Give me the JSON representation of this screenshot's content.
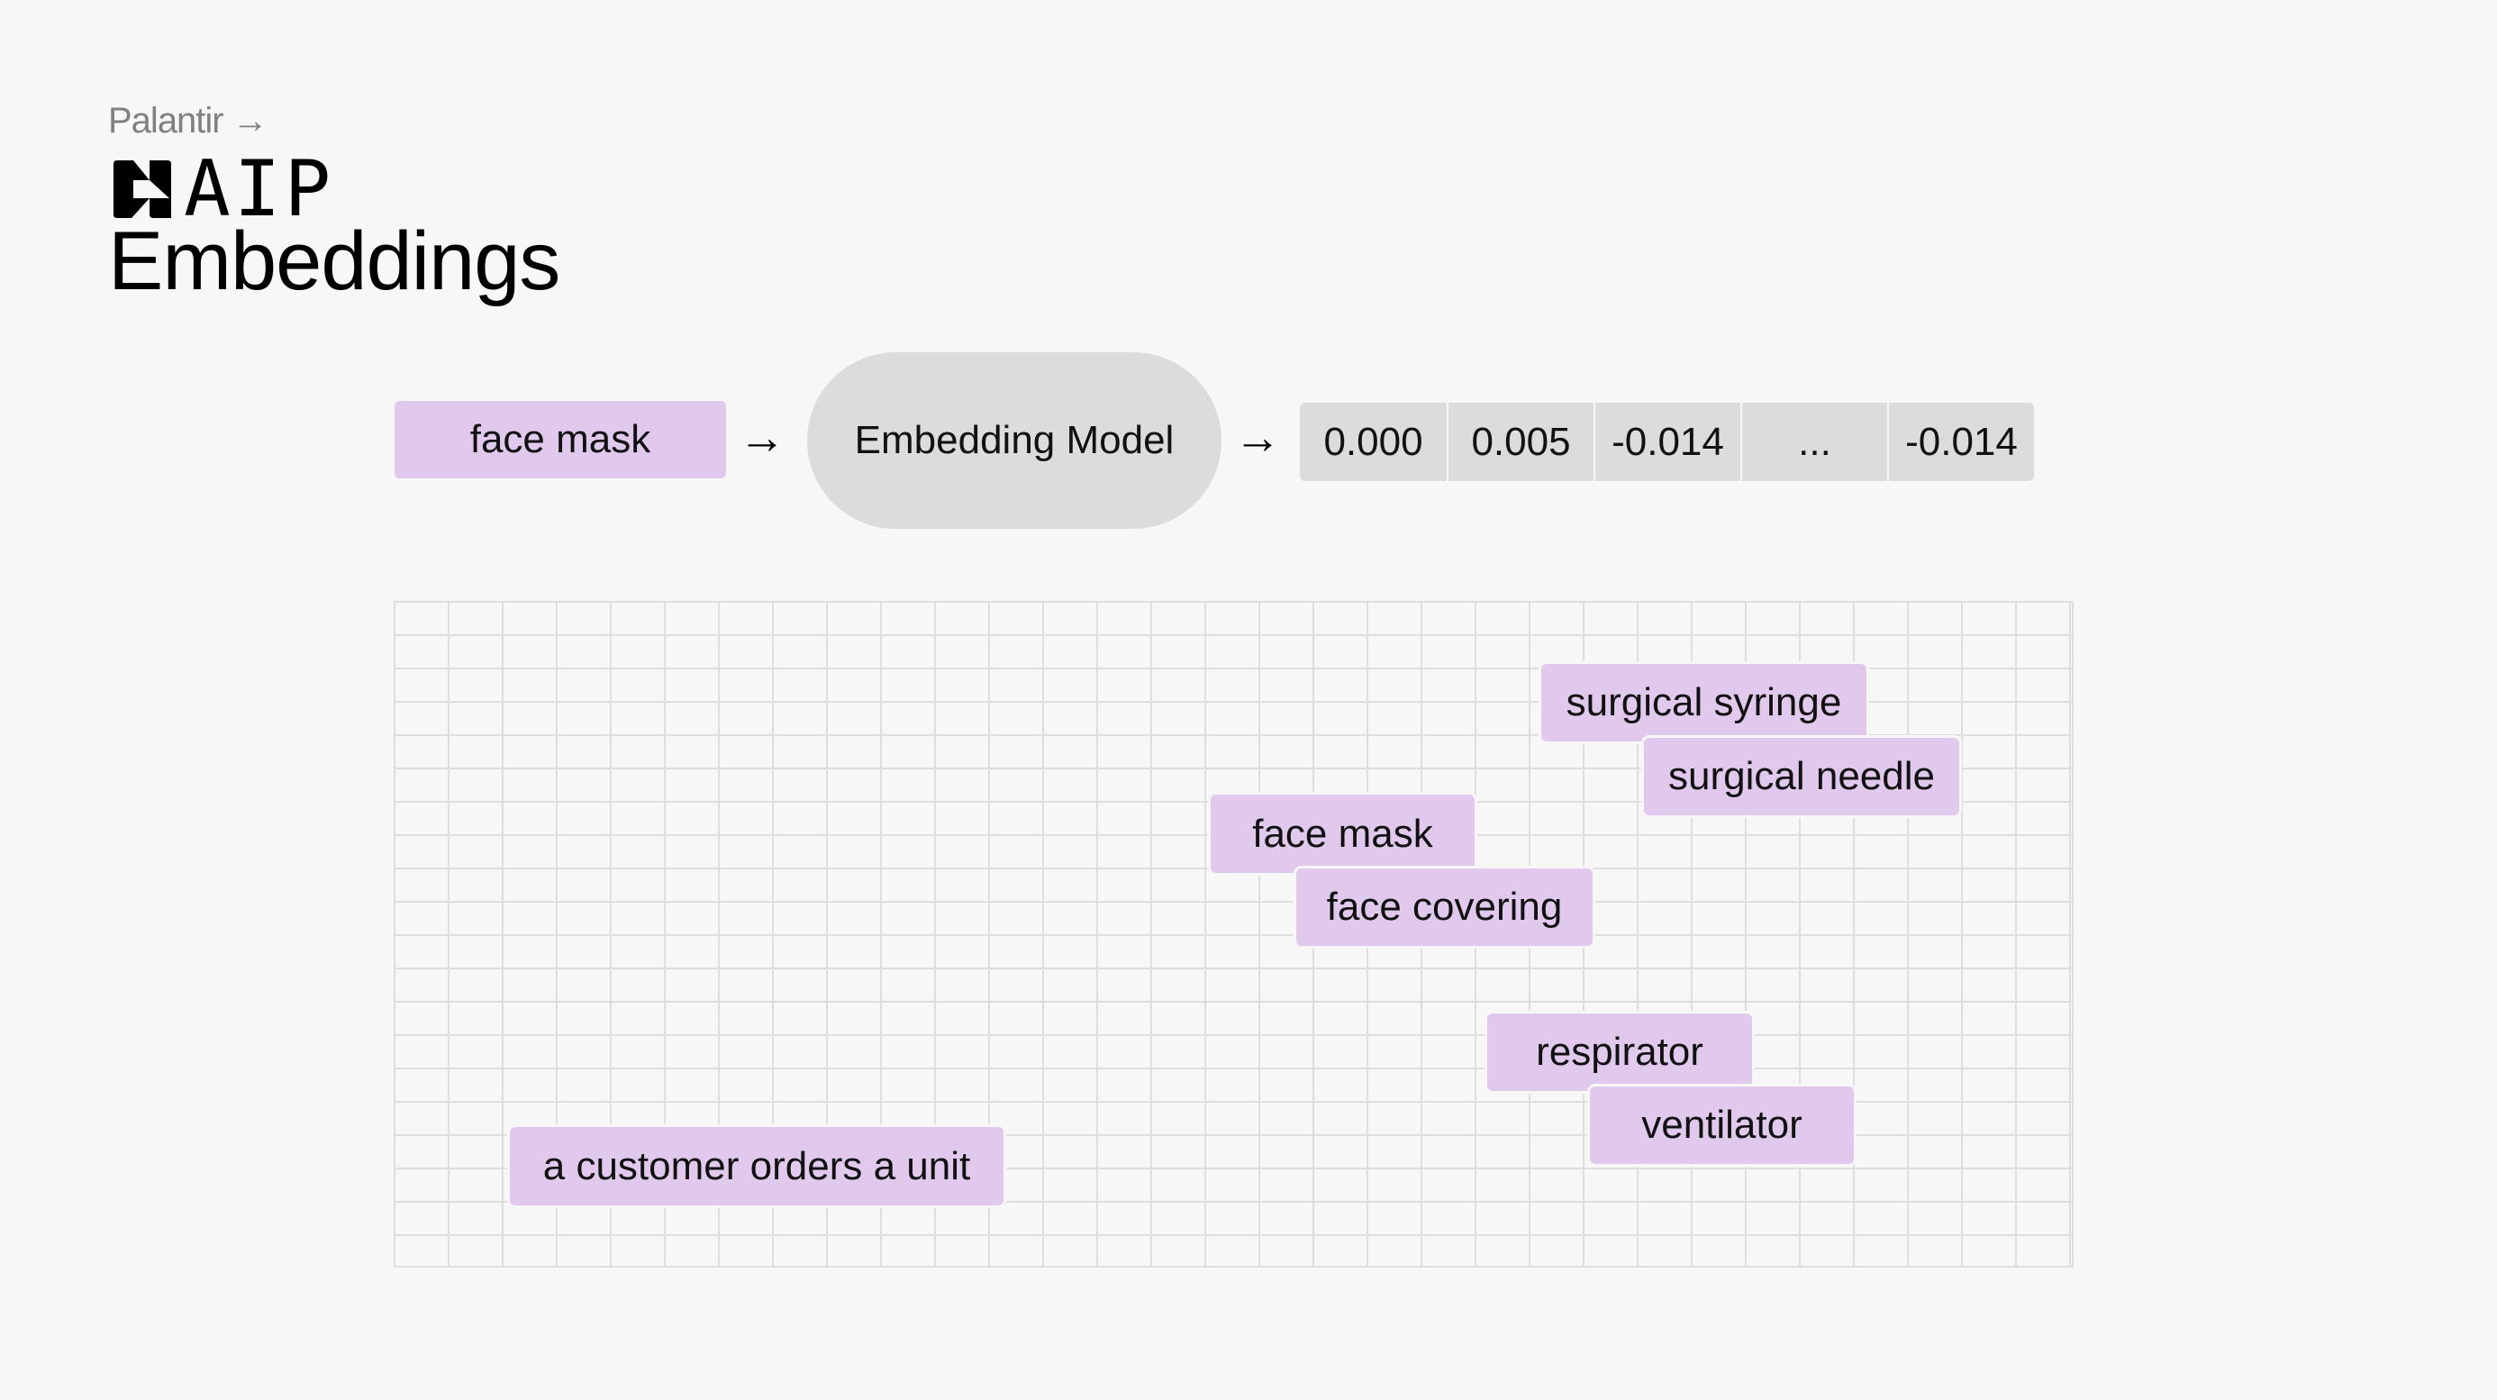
{
  "header": {
    "brand_link": "Palantir →",
    "logo_icon": "palantir-aip-logo-icon",
    "logo_text": "AIP",
    "title": "Embeddings"
  },
  "pipeline": {
    "input_label": "face mask",
    "arrow_1": "→",
    "model_label": "Embedding Model",
    "arrow_2": "→",
    "vector_values": [
      "0.000",
      "0.005",
      "-0.014",
      "...",
      "-0.014"
    ]
  },
  "embedding_space": {
    "labels": [
      {
        "text": "surgical syringe"
      },
      {
        "text": "surgical needle"
      },
      {
        "text": "face mask"
      },
      {
        "text": "face covering"
      },
      {
        "text": "respirator"
      },
      {
        "text": "ventilator"
      },
      {
        "text": "a customer orders a unit"
      }
    ]
  },
  "colors": {
    "background": "#f7f7f7",
    "label_fill": "#e1c9ee",
    "model_fill": "#dcdcdc",
    "grid_line": "#dedede"
  }
}
